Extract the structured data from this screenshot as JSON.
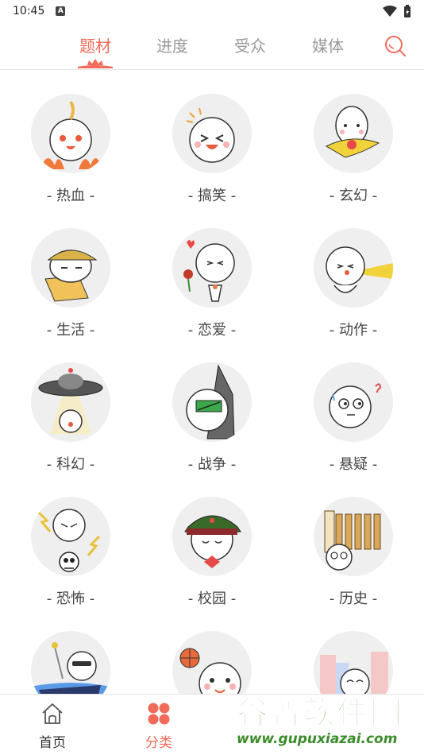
{
  "status_bar": {
    "time": "10:45"
  },
  "top_tabs": [
    {
      "label": "题材",
      "active": true
    },
    {
      "label": "进度",
      "active": false
    },
    {
      "label": "受众",
      "active": false
    },
    {
      "label": "媒体",
      "active": false
    }
  ],
  "categories": [
    {
      "label": "- 热血 -"
    },
    {
      "label": "- 搞笑 -"
    },
    {
      "label": "- 玄幻 -"
    },
    {
      "label": "- 生活 -"
    },
    {
      "label": "- 恋爱 -"
    },
    {
      "label": "- 动作 -"
    },
    {
      "label": "- 科幻 -"
    },
    {
      "label": "- 战争 -"
    },
    {
      "label": "- 悬疑 -"
    },
    {
      "label": "- 恐怖 -"
    },
    {
      "label": "- 校园 -"
    },
    {
      "label": "- 历史 -"
    }
  ],
  "bottom_nav": {
    "home_label": "首页",
    "category_label": "分类"
  },
  "watermark": {
    "text": "谷普软件园",
    "url": "www.gupuxiazai.com"
  },
  "colors": {
    "accent": "#f26b5a",
    "watermark": "#4aa534"
  }
}
